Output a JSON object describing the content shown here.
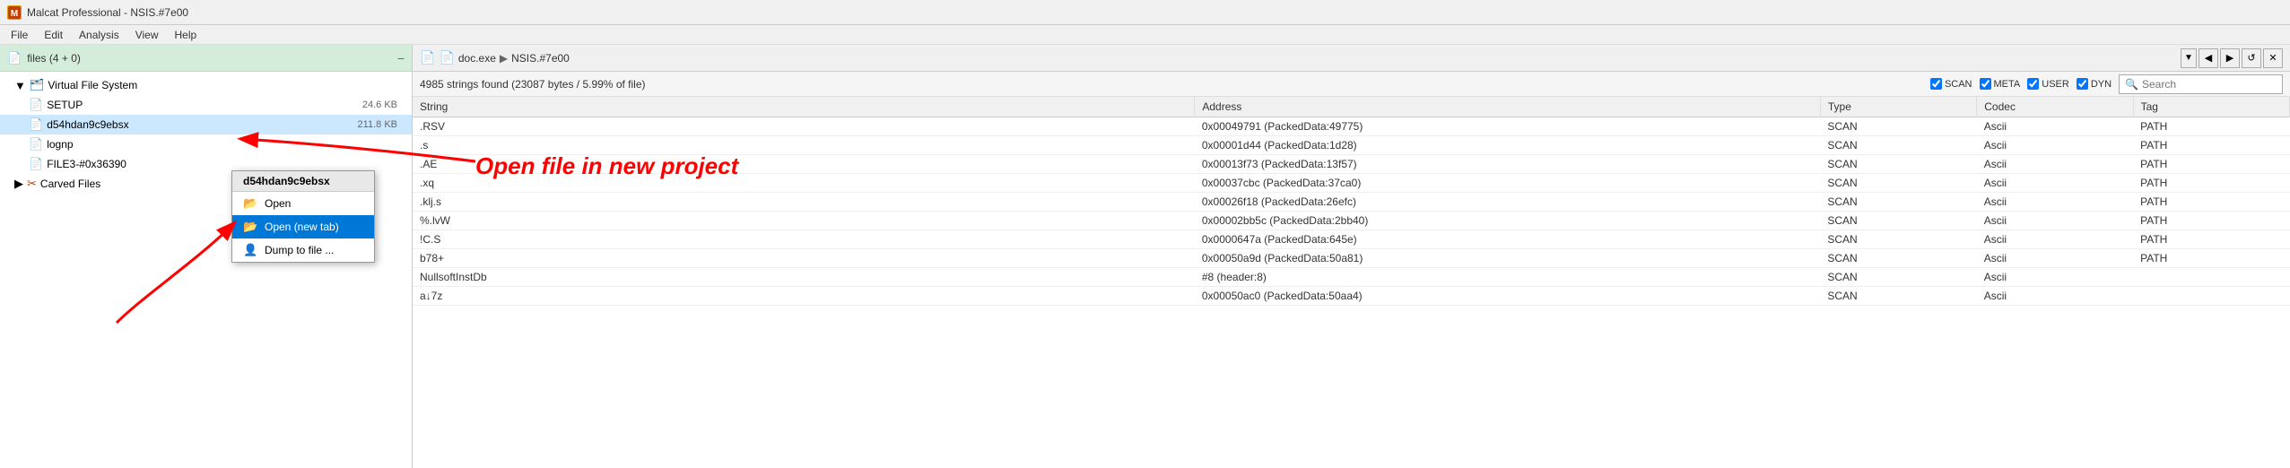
{
  "titleBar": {
    "icon": "M",
    "title": "Malcat Professional - NSIS.#7e00"
  },
  "menuBar": {
    "items": [
      "File",
      "Edit",
      "Analysis",
      "View",
      "Help"
    ]
  },
  "leftPanel": {
    "title": "files (4 + 0)",
    "collapseLabel": "−",
    "tree": [
      {
        "id": "vfs",
        "label": "Virtual File System",
        "icon": "🗂",
        "type": "vfs",
        "indent": 1
      },
      {
        "id": "setup",
        "label": "SETUP",
        "icon": "📄",
        "type": "file",
        "indent": 2,
        "size": ""
      },
      {
        "id": "d54hdan",
        "label": "d54hdan9c9ebsx",
        "icon": "📄",
        "type": "file",
        "indent": 2,
        "size": "211.8 KB",
        "selected": true
      },
      {
        "id": "lognp",
        "label": "lognp",
        "icon": "📄",
        "type": "file",
        "indent": 2,
        "size": ""
      },
      {
        "id": "file3",
        "label": "FILE3-#0x36390",
        "icon": "📄",
        "type": "file",
        "indent": 2,
        "size": ""
      },
      {
        "id": "carved",
        "label": "Carved Files",
        "icon": "✂",
        "type": "carved",
        "indent": 1
      }
    ],
    "treeItems": [
      {
        "label": "Virtual File System",
        "size": "",
        "indent": 1,
        "icon": "vfs"
      },
      {
        "label": "SETUP",
        "size": "24.6 KB",
        "indent": 2,
        "icon": "file"
      },
      {
        "label": "d54hdan9c9ebsx",
        "size": "211.8 KB",
        "indent": 2,
        "icon": "file",
        "selected": true
      },
      {
        "label": "lognp",
        "size": "",
        "indent": 2,
        "icon": "file"
      },
      {
        "label": "FILE3-#0x36390",
        "size": "",
        "indent": 2,
        "icon": "file"
      },
      {
        "label": "Carved Files",
        "size": "",
        "indent": 1,
        "icon": "carved"
      }
    ]
  },
  "contextMenu": {
    "header": "d54hdan9c9ebsx",
    "items": [
      {
        "label": "Open",
        "icon": "📂",
        "active": false
      },
      {
        "label": "Open (new tab)",
        "icon": "📂",
        "active": true
      },
      {
        "label": "Dump to file ...",
        "icon": "👤",
        "active": false
      }
    ]
  },
  "annotation": {
    "text": "Open file in new project"
  },
  "rightPanel": {
    "breadcrumb": [
      "doc.exe",
      "NSIS.#7e00"
    ],
    "status": "4985 strings found (23087 bytes / 5.99% of file)",
    "checkboxes": [
      "SCAN",
      "META",
      "USER",
      "DYN"
    ],
    "searchPlaceholder": "Search",
    "tableHeaders": [
      "String",
      "Address",
      "Type",
      "Codec",
      "Tag"
    ],
    "rows": [
      {
        "string": ".RSV",
        "address": "0x00049791 (PackedData:49775)",
        "type": "SCAN",
        "codec": "Ascii",
        "tag": "PATH"
      },
      {
        "string": ".s",
        "address": "0x00001d44 (PackedData:1d28)",
        "type": "SCAN",
        "codec": "Ascii",
        "tag": "PATH"
      },
      {
        "string": ".AE",
        "address": "0x00013f73 (PackedData:13f57)",
        "type": "SCAN",
        "codec": "Ascii",
        "tag": "PATH"
      },
      {
        "string": ".xq",
        "address": "0x00037cbc (PackedData:37ca0)",
        "type": "SCAN",
        "codec": "Ascii",
        "tag": "PATH"
      },
      {
        "string": ".klj.s",
        "address": "0x00026f18 (PackedData:26efc)",
        "type": "SCAN",
        "codec": "Ascii",
        "tag": "PATH"
      },
      {
        "string": "%.lvW",
        "address": "0x00002bb5c (PackedData:2bb40)",
        "type": "SCAN",
        "codec": "Ascii",
        "tag": "PATH"
      },
      {
        "string": "!C.S",
        "address": "0x0000647a (PackedData:645e)",
        "type": "SCAN",
        "codec": "Ascii",
        "tag": "PATH"
      },
      {
        "string": "b78+",
        "address": "0x00050a9d (PackedData:50a81)",
        "type": "SCAN",
        "codec": "Ascii",
        "tag": "PATH"
      },
      {
        "string": "NullsoftInstDb",
        "address": "#8 (header:8)",
        "type": "SCAN",
        "codec": "Ascii",
        "tag": ""
      },
      {
        "string": "a↓7z",
        "address": "0x00050ac0 (PackedData:50aa4)",
        "type": "SCAN",
        "codec": "Ascii",
        "tag": ""
      }
    ]
  }
}
